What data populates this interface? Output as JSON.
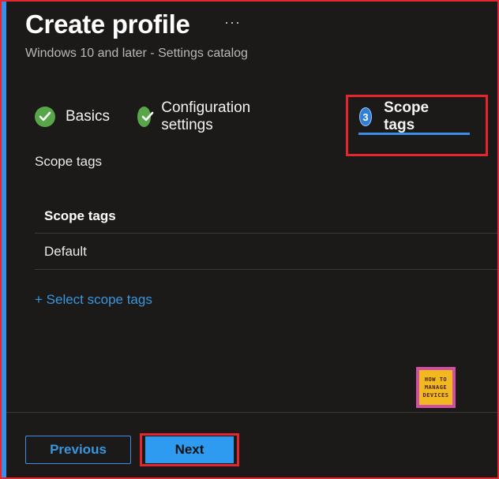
{
  "header": {
    "title": "Create profile",
    "more_label": "···",
    "subtitle": "Windows 10 and later - Settings catalog"
  },
  "steps": [
    {
      "label": "Basics",
      "status": "completed",
      "icon": "check-icon"
    },
    {
      "label": "Configuration settings",
      "status": "completed",
      "icon": "check-icon"
    },
    {
      "label": "Scope tags",
      "status": "active",
      "number": "3"
    }
  ],
  "section": {
    "label": "Scope tags",
    "table": {
      "header": "Scope tags",
      "rows": [
        "Default"
      ]
    },
    "add_link": "+ Select scope tags"
  },
  "logo": {
    "lines": [
      "HOW TO",
      "MANAGE",
      "DEVICES"
    ]
  },
  "footer": {
    "previous_label": "Previous",
    "next_label": "Next"
  },
  "colors": {
    "background": "#1b1a19",
    "accent": "#3a8ee6",
    "success": "#57a64a",
    "highlight": "#e5262f",
    "link": "#3a96dd"
  }
}
